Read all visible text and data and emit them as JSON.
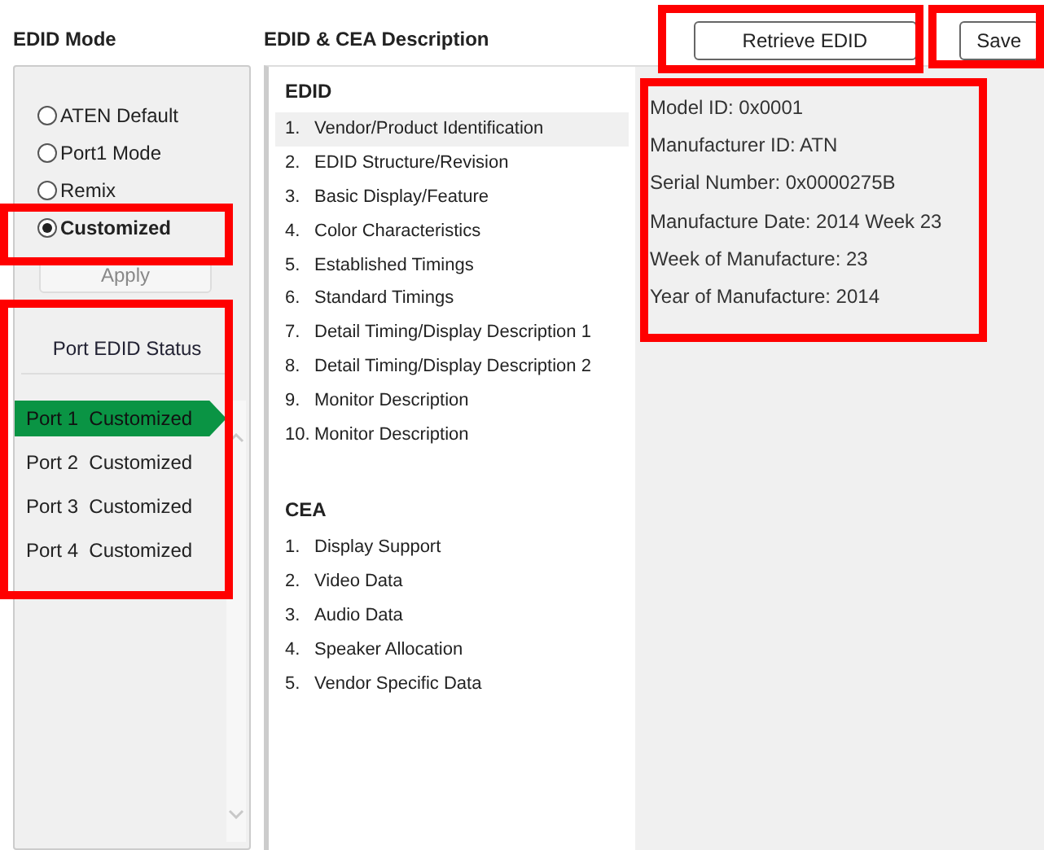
{
  "edid_mode": {
    "title": "EDID Mode",
    "options": [
      {
        "label": "ATEN Default",
        "selected": false
      },
      {
        "label": "Port1 Mode",
        "selected": false
      },
      {
        "label": "Remix",
        "selected": false
      },
      {
        "label": "Customized",
        "selected": true
      }
    ],
    "apply_button": {
      "label": "Apply",
      "disabled": true
    },
    "port_status": {
      "title": "Port EDID Status",
      "ports": [
        {
          "port": "Port 1",
          "status": "Customized",
          "selected": true
        },
        {
          "port": "Port 2",
          "status": "Customized",
          "selected": false
        },
        {
          "port": "Port 3",
          "status": "Customized",
          "selected": false
        },
        {
          "port": "Port 4",
          "status": "Customized",
          "selected": false
        }
      ]
    }
  },
  "description": {
    "title": "EDID & CEA Description",
    "sections": [
      {
        "heading": "EDID",
        "items": [
          {
            "number": "1.",
            "label": "Vendor/Product Identification",
            "selected": true
          },
          {
            "number": "2.",
            "label": "EDID Structure/Revision",
            "selected": false
          },
          {
            "number": "3.",
            "label": "Basic Display/Feature",
            "selected": false
          },
          {
            "number": "4.",
            "label": "Color Characteristics",
            "selected": false
          },
          {
            "number": "5.",
            "label": "Established Timings",
            "selected": false
          },
          {
            "number": "6.",
            "label": "Standard Timings",
            "selected": false
          },
          {
            "number": "7.",
            "label": "Detail Timing/Display Description 1",
            "selected": false
          },
          {
            "number": "8.",
            "label": "Detail Timing/Display Description 2",
            "selected": false
          },
          {
            "number": "9.",
            "label": "Monitor Description",
            "selected": false
          },
          {
            "number": "10.",
            "label": "Monitor Description",
            "selected": false
          }
        ]
      },
      {
        "heading": "CEA",
        "items": [
          {
            "number": "1.",
            "label": "Display Support",
            "selected": false
          },
          {
            "number": "2.",
            "label": "Video Data",
            "selected": false
          },
          {
            "number": "3.",
            "label": "Audio Data",
            "selected": false
          },
          {
            "number": "4.",
            "label": "Speaker Allocation",
            "selected": false
          },
          {
            "number": "5.",
            "label": "Vendor Specific Data",
            "selected": false
          }
        ]
      }
    ]
  },
  "toolbar": {
    "buttons": [
      "Retrieve EDID",
      "Save"
    ]
  },
  "details": [
    "Model ID: 0x0001",
    "Manufacturer ID: ATN",
    "Serial Number: 0x0000275B",
    "Manufacture Date: 2014 Week 23",
    "Week of Manufacture: 23",
    "Year of Manufacture: 2014"
  ]
}
